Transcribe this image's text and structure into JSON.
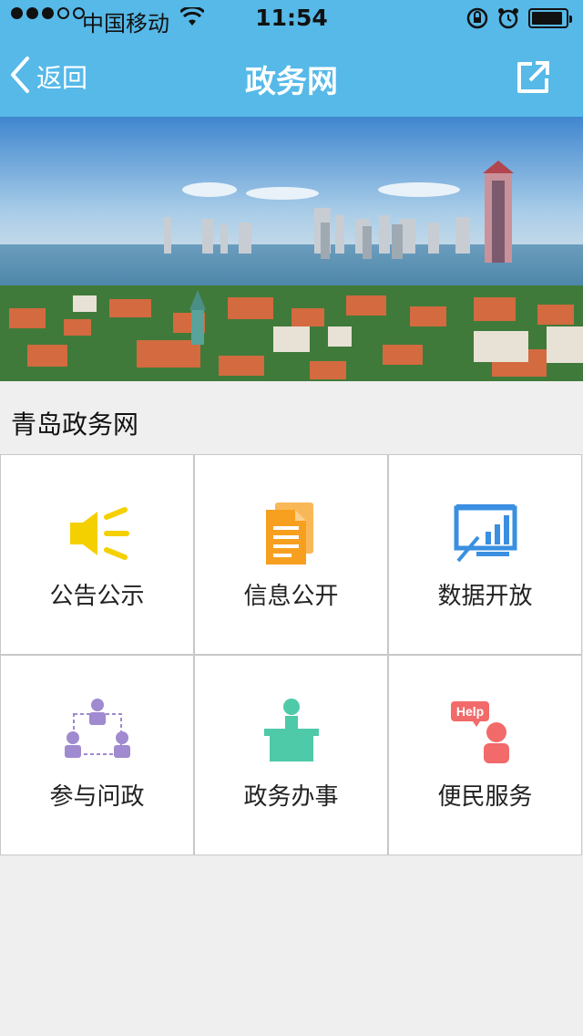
{
  "status_bar": {
    "carrier": "中国移动",
    "time": "11:54",
    "signal_strength": "3 of 5",
    "battery_level": 0.8
  },
  "nav": {
    "back_label": "返回",
    "title": "政务网",
    "back_icon": "chevron-left-icon",
    "share_icon": "share-icon"
  },
  "banner": {
    "description_icon": "city-photo"
  },
  "section": {
    "title": "青岛政务网"
  },
  "grid": {
    "items": [
      {
        "label": "公告公示",
        "icon": "megaphone-icon",
        "color": "#f5d000"
      },
      {
        "label": "信息公开",
        "icon": "document-icon",
        "color": "#f7a020"
      },
      {
        "label": "数据开放",
        "icon": "chart-board-icon",
        "color": "#3a8fe0"
      },
      {
        "label": "参与问政",
        "icon": "people-network-icon",
        "color": "#a08ad0"
      },
      {
        "label": "政务办事",
        "icon": "service-desk-icon",
        "color": "#4fcaa8"
      },
      {
        "label": "便民服务",
        "icon": "help-person-icon",
        "color": "#f26a6a"
      }
    ]
  },
  "colors": {
    "header": "#56b9e8",
    "background": "#efefef"
  }
}
